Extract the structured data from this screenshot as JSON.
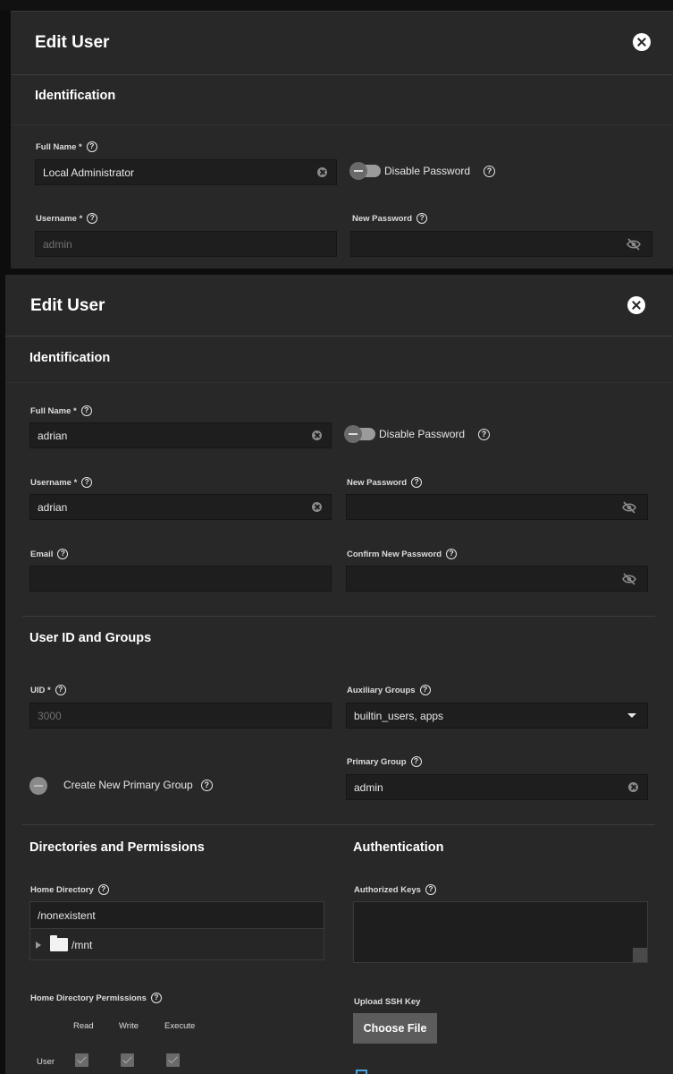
{
  "back_dialog": {
    "title": "Edit User",
    "identification_title": "Identification",
    "full_name_label": "Full Name *",
    "full_name_value": "Local Administrator",
    "disable_password_label": "Disable Password",
    "username_label": "Username *",
    "username_value": "admin",
    "new_password_label": "New Password"
  },
  "dialog": {
    "title": "Edit User",
    "identification": {
      "title": "Identification",
      "full_name_label": "Full Name *",
      "full_name_value": "adrian",
      "disable_password_label": "Disable Password",
      "username_label": "Username *",
      "username_value": "adrian",
      "new_password_label": "New Password",
      "email_label": "Email",
      "email_value": "",
      "confirm_password_label": "Confirm New Password"
    },
    "user_id_groups": {
      "title": "User ID and Groups",
      "uid_label": "UID *",
      "uid_value": "3000",
      "aux_groups_label": "Auxiliary Groups",
      "aux_groups_value": "builtin_users, apps",
      "create_primary_group_label": "Create New Primary Group",
      "primary_group_label": "Primary Group",
      "primary_group_value": "admin"
    },
    "directories": {
      "title": "Directories and Permissions",
      "home_directory_label": "Home Directory",
      "home_directory_value": "/nonexistent",
      "tree_item": "/mnt",
      "home_permissions_label": "Home Directory Permissions",
      "perm_columns": [
        "Read",
        "Write",
        "Execute"
      ],
      "perm_rows": [
        "User"
      ]
    },
    "authentication": {
      "title": "Authentication",
      "authorized_keys_label": "Authorized Keys",
      "upload_ssh_label": "Upload SSH Key",
      "choose_file_label": "Choose File"
    }
  },
  "icons": {
    "help": "help-circle-icon",
    "clear": "clear-circle-icon",
    "visibility": "eye-off-icon",
    "close": "close-circle-icon",
    "folder": "folder-icon"
  },
  "colors": {
    "panel_bg": "#282828",
    "input_bg": "#1e1e1e",
    "button_bg": "#5c5c5c",
    "accent": "#4aa3df"
  }
}
